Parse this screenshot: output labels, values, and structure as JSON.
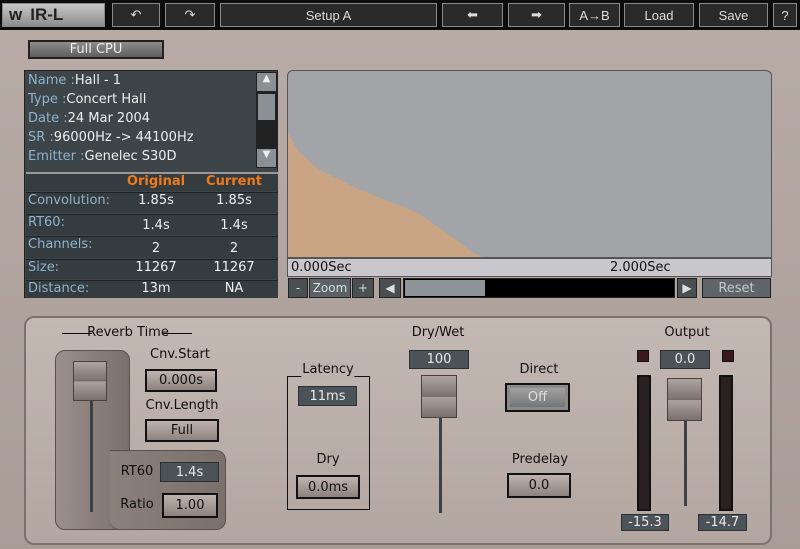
{
  "topbar": {
    "logo": "IR-L",
    "setup": "Setup A",
    "ab": "A→B",
    "load": "Load",
    "save": "Save",
    "help": "?"
  },
  "cpu_button": "Full CPU",
  "info": {
    "name_k": "Name :",
    "name": "Hall - 1",
    "type_k": "Type :",
    "type": "Concert Hall",
    "date_k": "Date :",
    "date": "24 Mar 2004",
    "sr_k": "SR :",
    "sr": "96000Hz -> 44100Hz",
    "emitter_k": "Emitter :",
    "emitter": "Genelec S30D"
  },
  "table": {
    "headers": [
      "Original",
      "Current"
    ],
    "rows": [
      {
        "label": "Convolution:",
        "original": "1.85s",
        "current": "1.85s"
      },
      {
        "label": "RT60:",
        "original": "1.4s",
        "current": "1.4s"
      },
      {
        "label": "Channels:",
        "original": "2",
        "current": "2"
      },
      {
        "label": "Size:",
        "original": "11267",
        "current": "11267"
      },
      {
        "label": "Distance:",
        "original": "13m",
        "current": "NA"
      }
    ]
  },
  "waveform": {
    "ruler": [
      "0.000Sec",
      "2.000Sec"
    ],
    "zoom_minus": "-",
    "zoom": "Zoom",
    "zoom_plus": "+",
    "reset": "Reset",
    "fill_color": "#c9a485"
  },
  "reverb": {
    "title": "Reverb Time",
    "cnv_start_label": "Cnv.Start",
    "cnv_start": "0.000s",
    "cnv_length_label": "Cnv.Length",
    "cnv_length": "Full",
    "rt60_label": "RT60",
    "rt60": "1.4s",
    "ratio_label": "Ratio",
    "ratio": "1.00"
  },
  "latency": {
    "title": "Latency",
    "value": "11ms",
    "dry_label": "Dry",
    "dry": "0.0ms"
  },
  "drywet": {
    "label": "Dry/Wet",
    "value": "100"
  },
  "direct": {
    "label": "Direct",
    "value": "Off"
  },
  "predelay": {
    "label": "Predelay",
    "value": "0.0"
  },
  "output": {
    "label": "Output",
    "value": "0.0",
    "left_peak": "-15.3",
    "right_peak": "-14.7"
  }
}
